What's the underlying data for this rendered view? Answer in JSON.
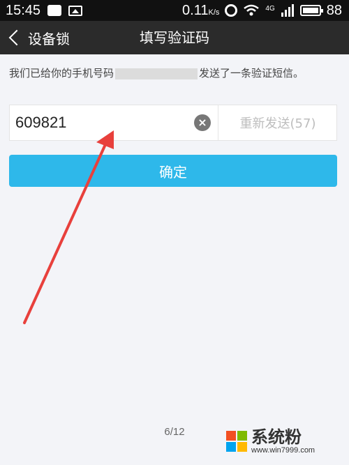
{
  "status_bar": {
    "time": "15:45",
    "speed": "0.11",
    "speed_unit": "K/s",
    "network": "4G",
    "battery": "88"
  },
  "nav": {
    "back_label": "设备锁",
    "title": "填写验证码"
  },
  "message": {
    "before": "我们已给你的手机号码",
    "after": "发送了一条验证短信。"
  },
  "code_input": {
    "value": "609821"
  },
  "resend_label": "重新发送(57)",
  "confirm_label": "确定",
  "page_indicator": "6/12",
  "watermark": {
    "brand": "系统粉",
    "url": "www.win7999.com",
    "logo_colors": [
      "#f25022",
      "#7fba00",
      "#00a4ef",
      "#ffb900"
    ]
  },
  "colors": {
    "accent": "#2eb8ea",
    "annotation": "#e8403c"
  }
}
